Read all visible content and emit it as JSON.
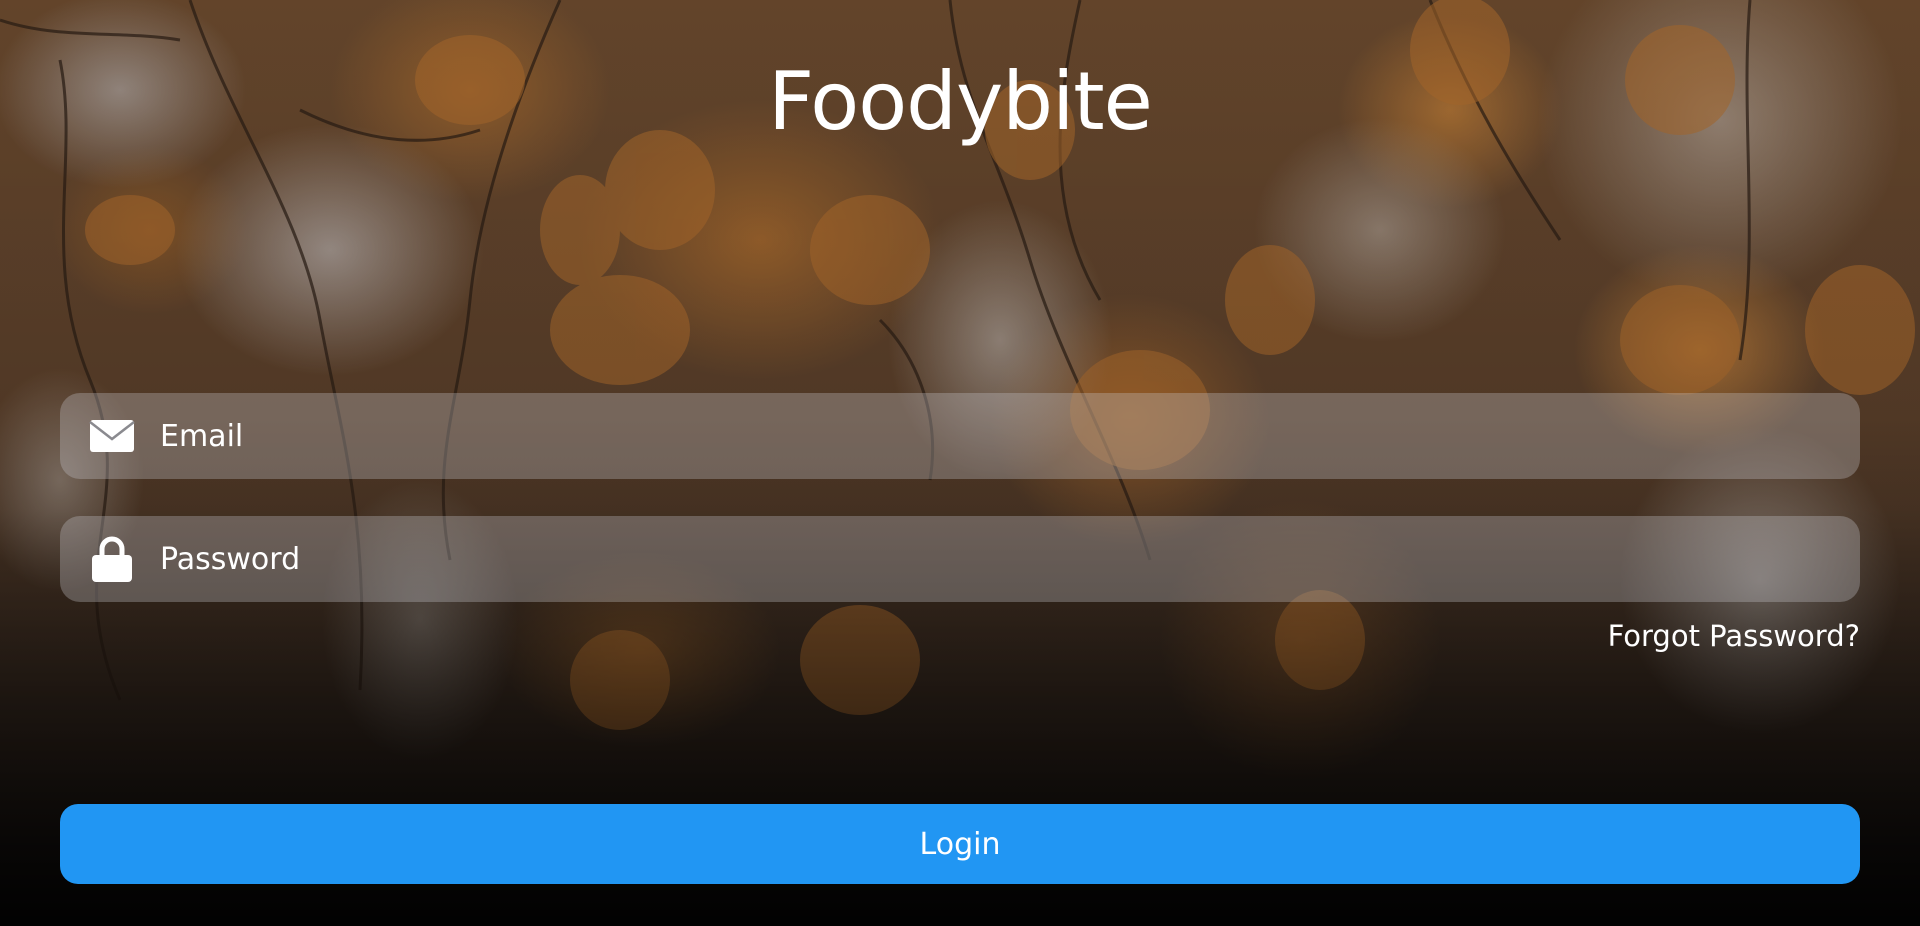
{
  "app": {
    "title": "Foodybite"
  },
  "form": {
    "email": {
      "placeholder": "Email",
      "value": "",
      "icon": "envelope-icon"
    },
    "password": {
      "placeholder": "Password",
      "value": "",
      "icon": "lock-icon"
    },
    "forgot_password_label": "Forgot Password?",
    "login_label": "Login"
  },
  "colors": {
    "login_button": "#2196f3",
    "text": "#ffffff"
  }
}
